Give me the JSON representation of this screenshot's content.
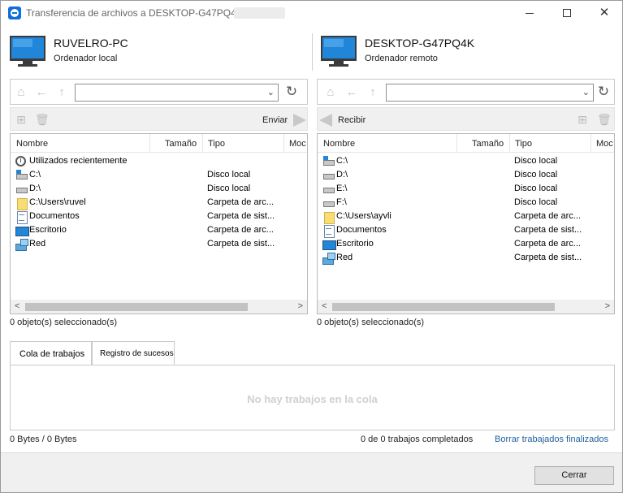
{
  "window": {
    "title": "Transferencia de archivos a DESKTOP-G47PQ4K ("
  },
  "local": {
    "pc_name": "RUVELRO-PC",
    "pc_sub": "Ordenador local",
    "send_label": "Enviar",
    "columns": [
      "Nombre",
      "Tamaño",
      "Tipo",
      "Moc"
    ],
    "items": [
      {
        "icon": "clock-icon",
        "name": "Utilizados recientemente",
        "type": ""
      },
      {
        "icon": "windows-drive-icon",
        "name": "C:\\",
        "type": "Disco local"
      },
      {
        "icon": "drive-icon",
        "name": "D:\\",
        "type": "Disco local"
      },
      {
        "icon": "folder-icon",
        "name": "C:\\Users\\ruvel",
        "type": "Carpeta de arc..."
      },
      {
        "icon": "documents-icon",
        "name": "Documentos",
        "type": "Carpeta de sist..."
      },
      {
        "icon": "desktop-icon",
        "name": "Escritorio",
        "type": "Carpeta de arc..."
      },
      {
        "icon": "network-icon",
        "name": "Red",
        "type": "Carpeta de sist..."
      }
    ],
    "selection": "0 objeto(s) seleccionado(s)"
  },
  "remote": {
    "pc_name": "DESKTOP-G47PQ4K",
    "pc_sub": "Ordenador remoto",
    "receive_label": "Recibir",
    "columns": [
      "Nombre",
      "Tamaño",
      "Tipo",
      "Moc"
    ],
    "items": [
      {
        "icon": "windows-drive-icon",
        "name": "C:\\",
        "type": "Disco local"
      },
      {
        "icon": "drive-icon",
        "name": "D:\\",
        "type": "Disco local"
      },
      {
        "icon": "drive-icon",
        "name": "E:\\",
        "type": "Disco local"
      },
      {
        "icon": "drive-icon",
        "name": "F:\\",
        "type": "Disco local"
      },
      {
        "icon": "folder-icon",
        "name": "C:\\Users\\ayvli",
        "type": "Carpeta de arc..."
      },
      {
        "icon": "documents-icon",
        "name": "Documentos",
        "type": "Carpeta de sist..."
      },
      {
        "icon": "desktop-icon",
        "name": "Escritorio",
        "type": "Carpeta de arc..."
      },
      {
        "icon": "network-icon",
        "name": "Red",
        "type": "Carpeta de sist..."
      }
    ],
    "selection": "0 objeto(s) seleccionado(s)"
  },
  "tabs": {
    "jobs": "Cola de trabajos",
    "log": "Registro de sucesos"
  },
  "queue": {
    "empty": "No hay trabajos en la cola"
  },
  "status": {
    "bytes": "0 Bytes / 0 Bytes",
    "completed": "0 de 0 trabajos completados",
    "clear_link": "Borrar trabajados finalizados"
  },
  "footer": {
    "close_label": "Cerrar"
  }
}
